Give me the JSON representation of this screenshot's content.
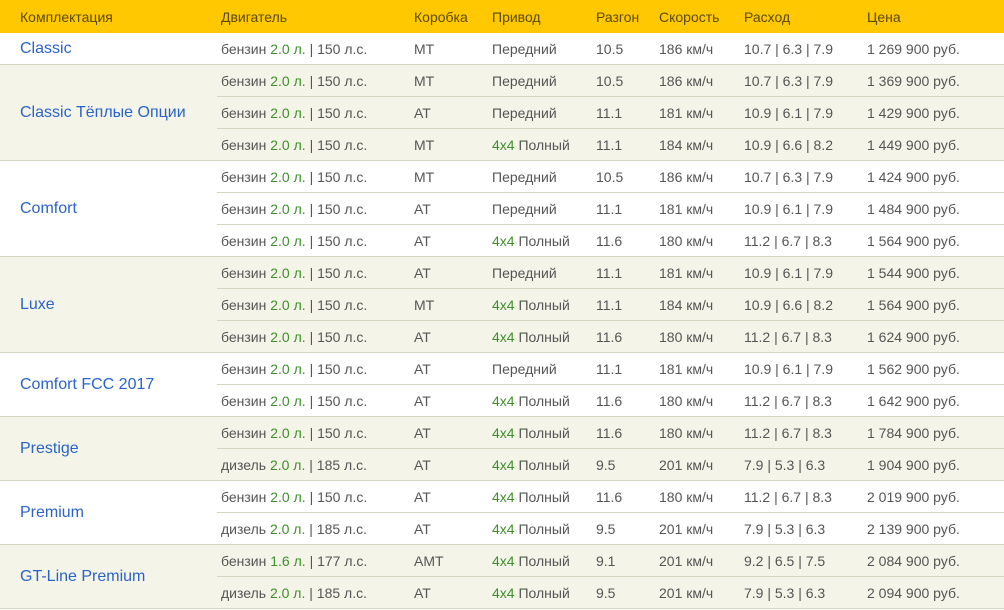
{
  "headers": [
    "Комплектация",
    "Двигатель",
    "Коробка",
    "Привод",
    "Разгон",
    "Скорость",
    "Расход",
    "Цена"
  ],
  "groups": [
    {
      "trim": "Classic",
      "rows": [
        {
          "fuel": "бензин",
          "vol": "2.0 л.",
          "hp": "| 150 л.с.",
          "gear": "MT",
          "d4": "",
          "drive": "Передний",
          "accel": "10.5",
          "speed": "186 км/ч",
          "cons": "10.7 | 6.3 | 7.9",
          "price": "1 269 900 руб."
        }
      ]
    },
    {
      "trim": "Classic Тёплые Опции",
      "rows": [
        {
          "fuel": "бензин",
          "vol": "2.0 л.",
          "hp": "| 150 л.с.",
          "gear": "MT",
          "d4": "",
          "drive": "Передний",
          "accel": "10.5",
          "speed": "186 км/ч",
          "cons": "10.7 | 6.3 | 7.9",
          "price": "1 369 900 руб."
        },
        {
          "fuel": "бензин",
          "vol": "2.0 л.",
          "hp": "| 150 л.с.",
          "gear": "AT",
          "d4": "",
          "drive": "Передний",
          "accel": "11.1",
          "speed": "181 км/ч",
          "cons": "10.9 | 6.1 | 7.9",
          "price": "1 429 900 руб."
        },
        {
          "fuel": "бензин",
          "vol": "2.0 л.",
          "hp": "| 150 л.с.",
          "gear": "MT",
          "d4": "4x4",
          "drive": "Полный",
          "accel": "11.1",
          "speed": "184 км/ч",
          "cons": "10.9 | 6.6 | 8.2",
          "price": "1 449 900 руб."
        }
      ]
    },
    {
      "trim": "Comfort",
      "rows": [
        {
          "fuel": "бензин",
          "vol": "2.0 л.",
          "hp": "| 150 л.с.",
          "gear": "MT",
          "d4": "",
          "drive": "Передний",
          "accel": "10.5",
          "speed": "186 км/ч",
          "cons": "10.7 | 6.3 | 7.9",
          "price": "1 424 900 руб."
        },
        {
          "fuel": "бензин",
          "vol": "2.0 л.",
          "hp": "| 150 л.с.",
          "gear": "AT",
          "d4": "",
          "drive": "Передний",
          "accel": "11.1",
          "speed": "181 км/ч",
          "cons": "10.9 | 6.1 | 7.9",
          "price": "1 484 900 руб."
        },
        {
          "fuel": "бензин",
          "vol": "2.0 л.",
          "hp": "| 150 л.с.",
          "gear": "AT",
          "d4": "4x4",
          "drive": "Полный",
          "accel": "11.6",
          "speed": "180 км/ч",
          "cons": "11.2 | 6.7 | 8.3",
          "price": "1 564 900 руб."
        }
      ]
    },
    {
      "trim": "Luxe",
      "rows": [
        {
          "fuel": "бензин",
          "vol": "2.0 л.",
          "hp": "| 150 л.с.",
          "gear": "AT",
          "d4": "",
          "drive": "Передний",
          "accel": "11.1",
          "speed": "181 км/ч",
          "cons": "10.9 | 6.1 | 7.9",
          "price": "1 544 900 руб."
        },
        {
          "fuel": "бензин",
          "vol": "2.0 л.",
          "hp": "| 150 л.с.",
          "gear": "MT",
          "d4": "4x4",
          "drive": "Полный",
          "accel": "11.1",
          "speed": "184 км/ч",
          "cons": "10.9 | 6.6 | 8.2",
          "price": "1 564 900 руб."
        },
        {
          "fuel": "бензин",
          "vol": "2.0 л.",
          "hp": "| 150 л.с.",
          "gear": "AT",
          "d4": "4x4",
          "drive": "Полный",
          "accel": "11.6",
          "speed": "180 км/ч",
          "cons": "11.2 | 6.7 | 8.3",
          "price": "1 624 900 руб."
        }
      ]
    },
    {
      "trim": "Comfort FCC 2017",
      "rows": [
        {
          "fuel": "бензин",
          "vol": "2.0 л.",
          "hp": "| 150 л.с.",
          "gear": "AT",
          "d4": "",
          "drive": "Передний",
          "accel": "11.1",
          "speed": "181 км/ч",
          "cons": "10.9 | 6.1 | 7.9",
          "price": "1 562 900 руб."
        },
        {
          "fuel": "бензин",
          "vol": "2.0 л.",
          "hp": "| 150 л.с.",
          "gear": "AT",
          "d4": "4x4",
          "drive": "Полный",
          "accel": "11.6",
          "speed": "180 км/ч",
          "cons": "11.2 | 6.7 | 8.3",
          "price": "1 642 900 руб."
        }
      ]
    },
    {
      "trim": "Prestige",
      "rows": [
        {
          "fuel": "бензин",
          "vol": "2.0 л.",
          "hp": "| 150 л.с.",
          "gear": "AT",
          "d4": "4x4",
          "drive": "Полный",
          "accel": "11.6",
          "speed": "180 км/ч",
          "cons": "11.2 | 6.7 | 8.3",
          "price": "1 784 900 руб."
        },
        {
          "fuel": "дизель",
          "vol": "2.0 л.",
          "hp": "| 185 л.с.",
          "gear": "AT",
          "d4": "4x4",
          "drive": "Полный",
          "accel": "9.5",
          "speed": "201 км/ч",
          "cons": "7.9 | 5.3 | 6.3",
          "price": "1 904 900 руб."
        }
      ]
    },
    {
      "trim": "Premium",
      "rows": [
        {
          "fuel": "бензин",
          "vol": "2.0 л.",
          "hp": "| 150 л.с.",
          "gear": "AT",
          "d4": "4x4",
          "drive": "Полный",
          "accel": "11.6",
          "speed": "180 км/ч",
          "cons": "11.2 | 6.7 | 8.3",
          "price": "2 019 900 руб."
        },
        {
          "fuel": "дизель",
          "vol": "2.0 л.",
          "hp": "| 185 л.с.",
          "gear": "AT",
          "d4": "4x4",
          "drive": "Полный",
          "accel": "9.5",
          "speed": "201 км/ч",
          "cons": "7.9 | 5.3 | 6.3",
          "price": "2 139 900 руб."
        }
      ]
    },
    {
      "trim": "GT-Line Premium",
      "rows": [
        {
          "fuel": "бензин",
          "vol": "1.6 л.",
          "hp": "| 177 л.с.",
          "gear": "AMT",
          "d4": "4x4",
          "drive": "Полный",
          "accel": "9.1",
          "speed": "201 км/ч",
          "cons": "9.2 | 6.5 | 7.5",
          "price": "2 084 900 руб."
        },
        {
          "fuel": "дизель",
          "vol": "2.0 л.",
          "hp": "| 185 л.с.",
          "gear": "AT",
          "d4": "4x4",
          "drive": "Полный",
          "accel": "9.5",
          "speed": "201 км/ч",
          "cons": "7.9 | 5.3 | 6.3",
          "price": "2 094 900 руб."
        }
      ]
    }
  ]
}
